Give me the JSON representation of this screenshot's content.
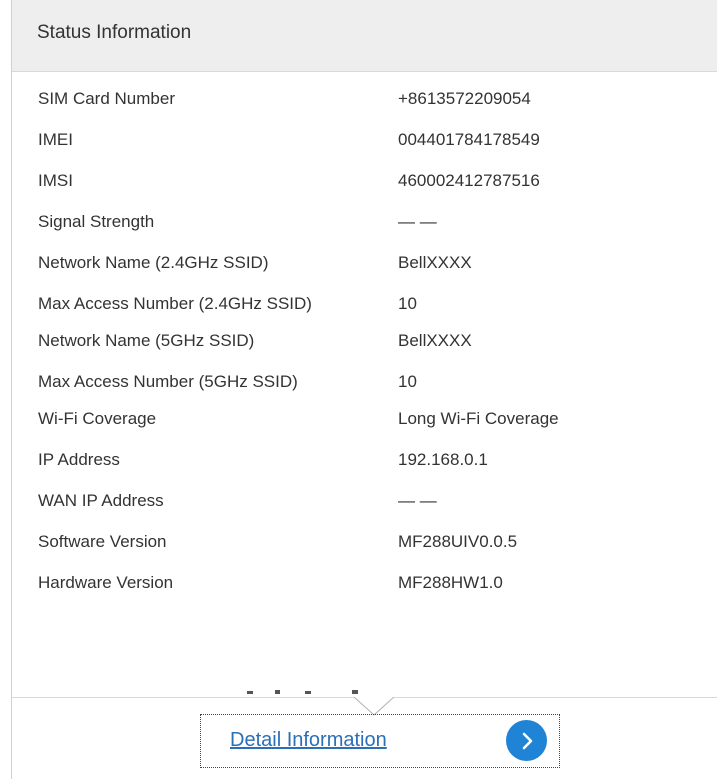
{
  "panel": {
    "title": "Status Information"
  },
  "rows": [
    {
      "label": "SIM Card Number",
      "value": "+8613572209054"
    },
    {
      "label": "IMEI",
      "value": "004401784178549"
    },
    {
      "label": "IMSI",
      "value": "460002412787516"
    },
    {
      "label": "Signal Strength",
      "value": "— —"
    },
    {
      "label": "Network Name (2.4GHz SSID)",
      "value": "BellXXXX"
    },
    {
      "label": "Max Access Number (2.4GHz SSID)",
      "value": "10"
    },
    {
      "label": "Network Name (5GHz SSID)",
      "value": "BellXXXX"
    },
    {
      "label": "Max Access Number (5GHz SSID)",
      "value": "10"
    },
    {
      "label": "Wi-Fi Coverage",
      "value": "Long Wi-Fi Coverage"
    },
    {
      "label": "IP Address",
      "value": "192.168.0.1"
    },
    {
      "label": "WAN IP Address",
      "value": "— —"
    },
    {
      "label": "Software Version",
      "value": "MF288UIV0.0.5"
    },
    {
      "label": "Hardware Version",
      "value": "MF288HW1.0"
    }
  ],
  "detail": {
    "link_label": "Detail Information",
    "arrow_icon": "chevron-right-icon",
    "accent_color": "#1f84d6",
    "link_color": "#2b6fb8"
  }
}
